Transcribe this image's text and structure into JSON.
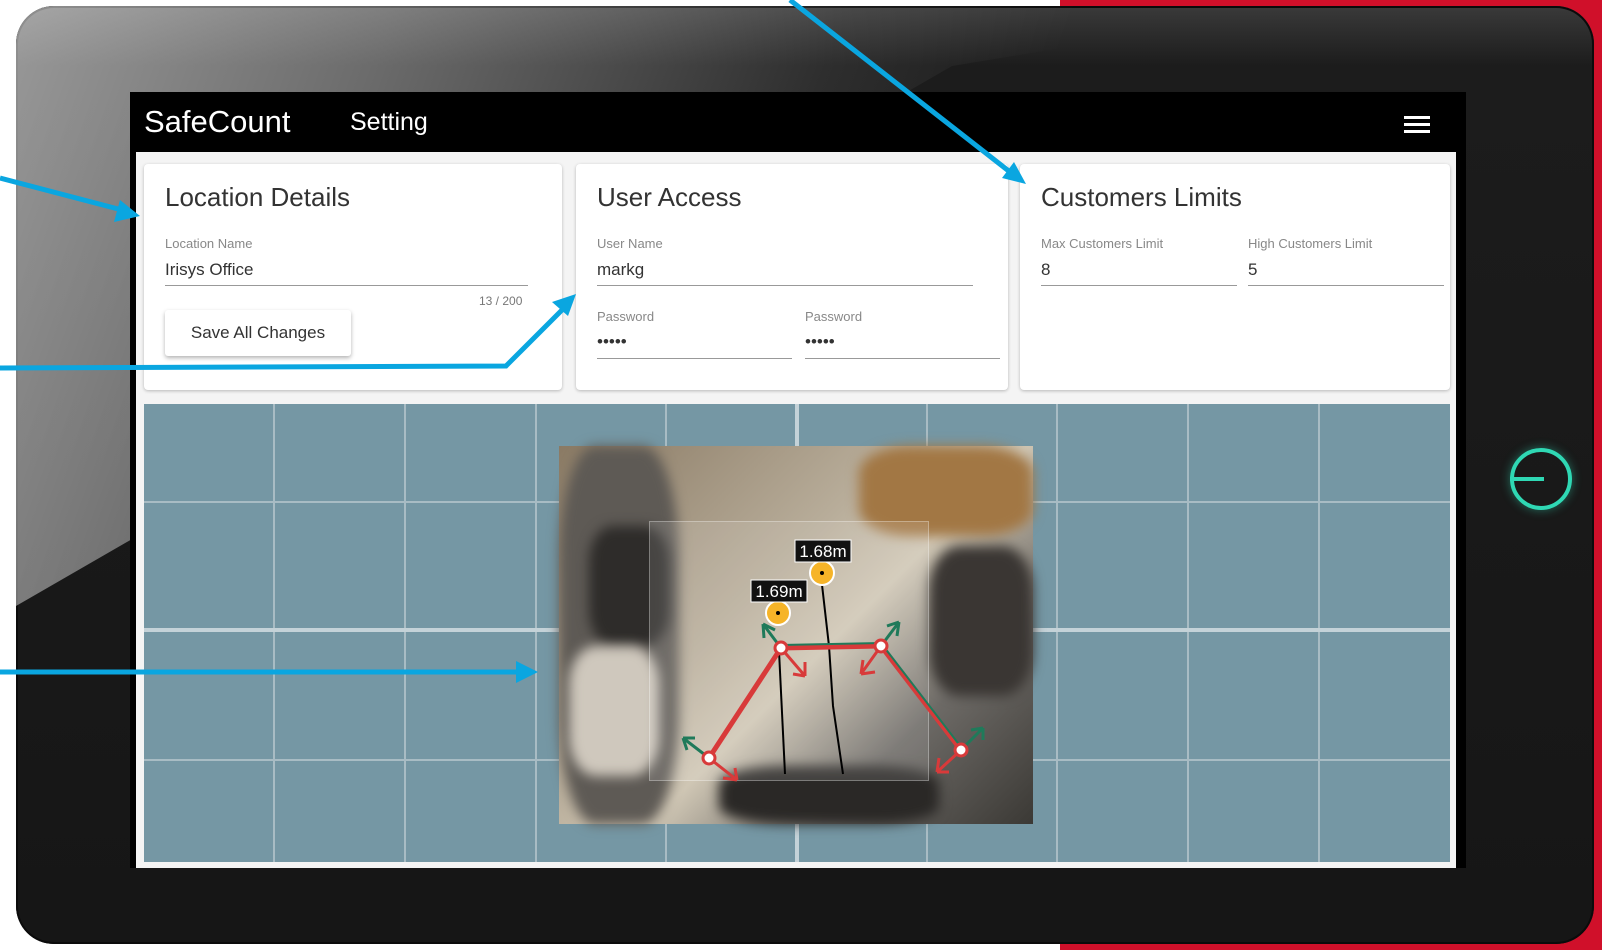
{
  "app": {
    "name": "SafeCount",
    "page": "Setting"
  },
  "location_card": {
    "title": "Location Details",
    "field_label": "Location Name",
    "field_value": "Irisys Office",
    "counter": "13 / 200",
    "save_label": "Save All Changes"
  },
  "user_card": {
    "title": "User Access",
    "username_label": "User Name",
    "username_value": "markg",
    "password_label": "Password",
    "password_value": "•••••",
    "password2_label": "Password",
    "password2_value": "•••••"
  },
  "limits_card": {
    "title": "Customers Limits",
    "max_label": "Max Customers Limit",
    "max_value": "8",
    "high_label": "High Customers Limit",
    "high_value": "5"
  },
  "camera": {
    "person1_height": "1.68m",
    "person2_height": "1.69m"
  },
  "colors": {
    "accent_red": "#d0102a",
    "annotation_arrow": "#0aa6e0",
    "line_red": "#d83a3a",
    "line_green": "#1f7a5a",
    "marker_yellow": "#f6b428",
    "power_teal": "#2fd8b4",
    "map_background": "#7597a4"
  },
  "icons": {
    "menu": "hamburger-menu-icon",
    "power": "power-icon"
  }
}
